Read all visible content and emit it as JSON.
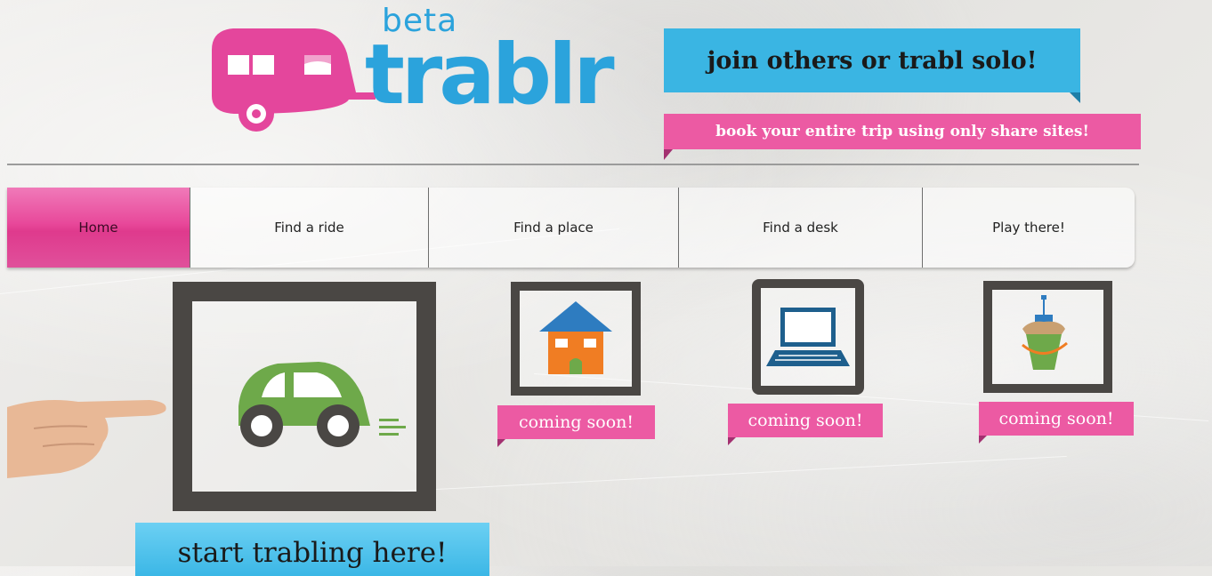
{
  "logo": {
    "word": "trablr",
    "badge": "beta"
  },
  "banners": {
    "tagline": "join others or trabl solo!",
    "subtagline": "book your entire trip using only share sites!"
  },
  "nav": {
    "items": [
      {
        "label": "Home",
        "active": true
      },
      {
        "label": "Find a ride",
        "active": false
      },
      {
        "label": "Find a place",
        "active": false
      },
      {
        "label": "Find a desk",
        "active": false
      },
      {
        "label": "Play there!",
        "active": false
      }
    ]
  },
  "tiles": [
    {
      "icon": "car-icon",
      "cta": "start trabling here!"
    },
    {
      "icon": "house-icon",
      "tag": "coming soon!"
    },
    {
      "icon": "laptop-icon",
      "tag": "coming soon!"
    },
    {
      "icon": "sandcastle-bucket-icon",
      "tag": "coming soon!"
    }
  ],
  "colors": {
    "pink": "#ec5aa3",
    "blue": "#3ab5e3",
    "frame": "#4a4744",
    "car": "#6ea94a"
  }
}
